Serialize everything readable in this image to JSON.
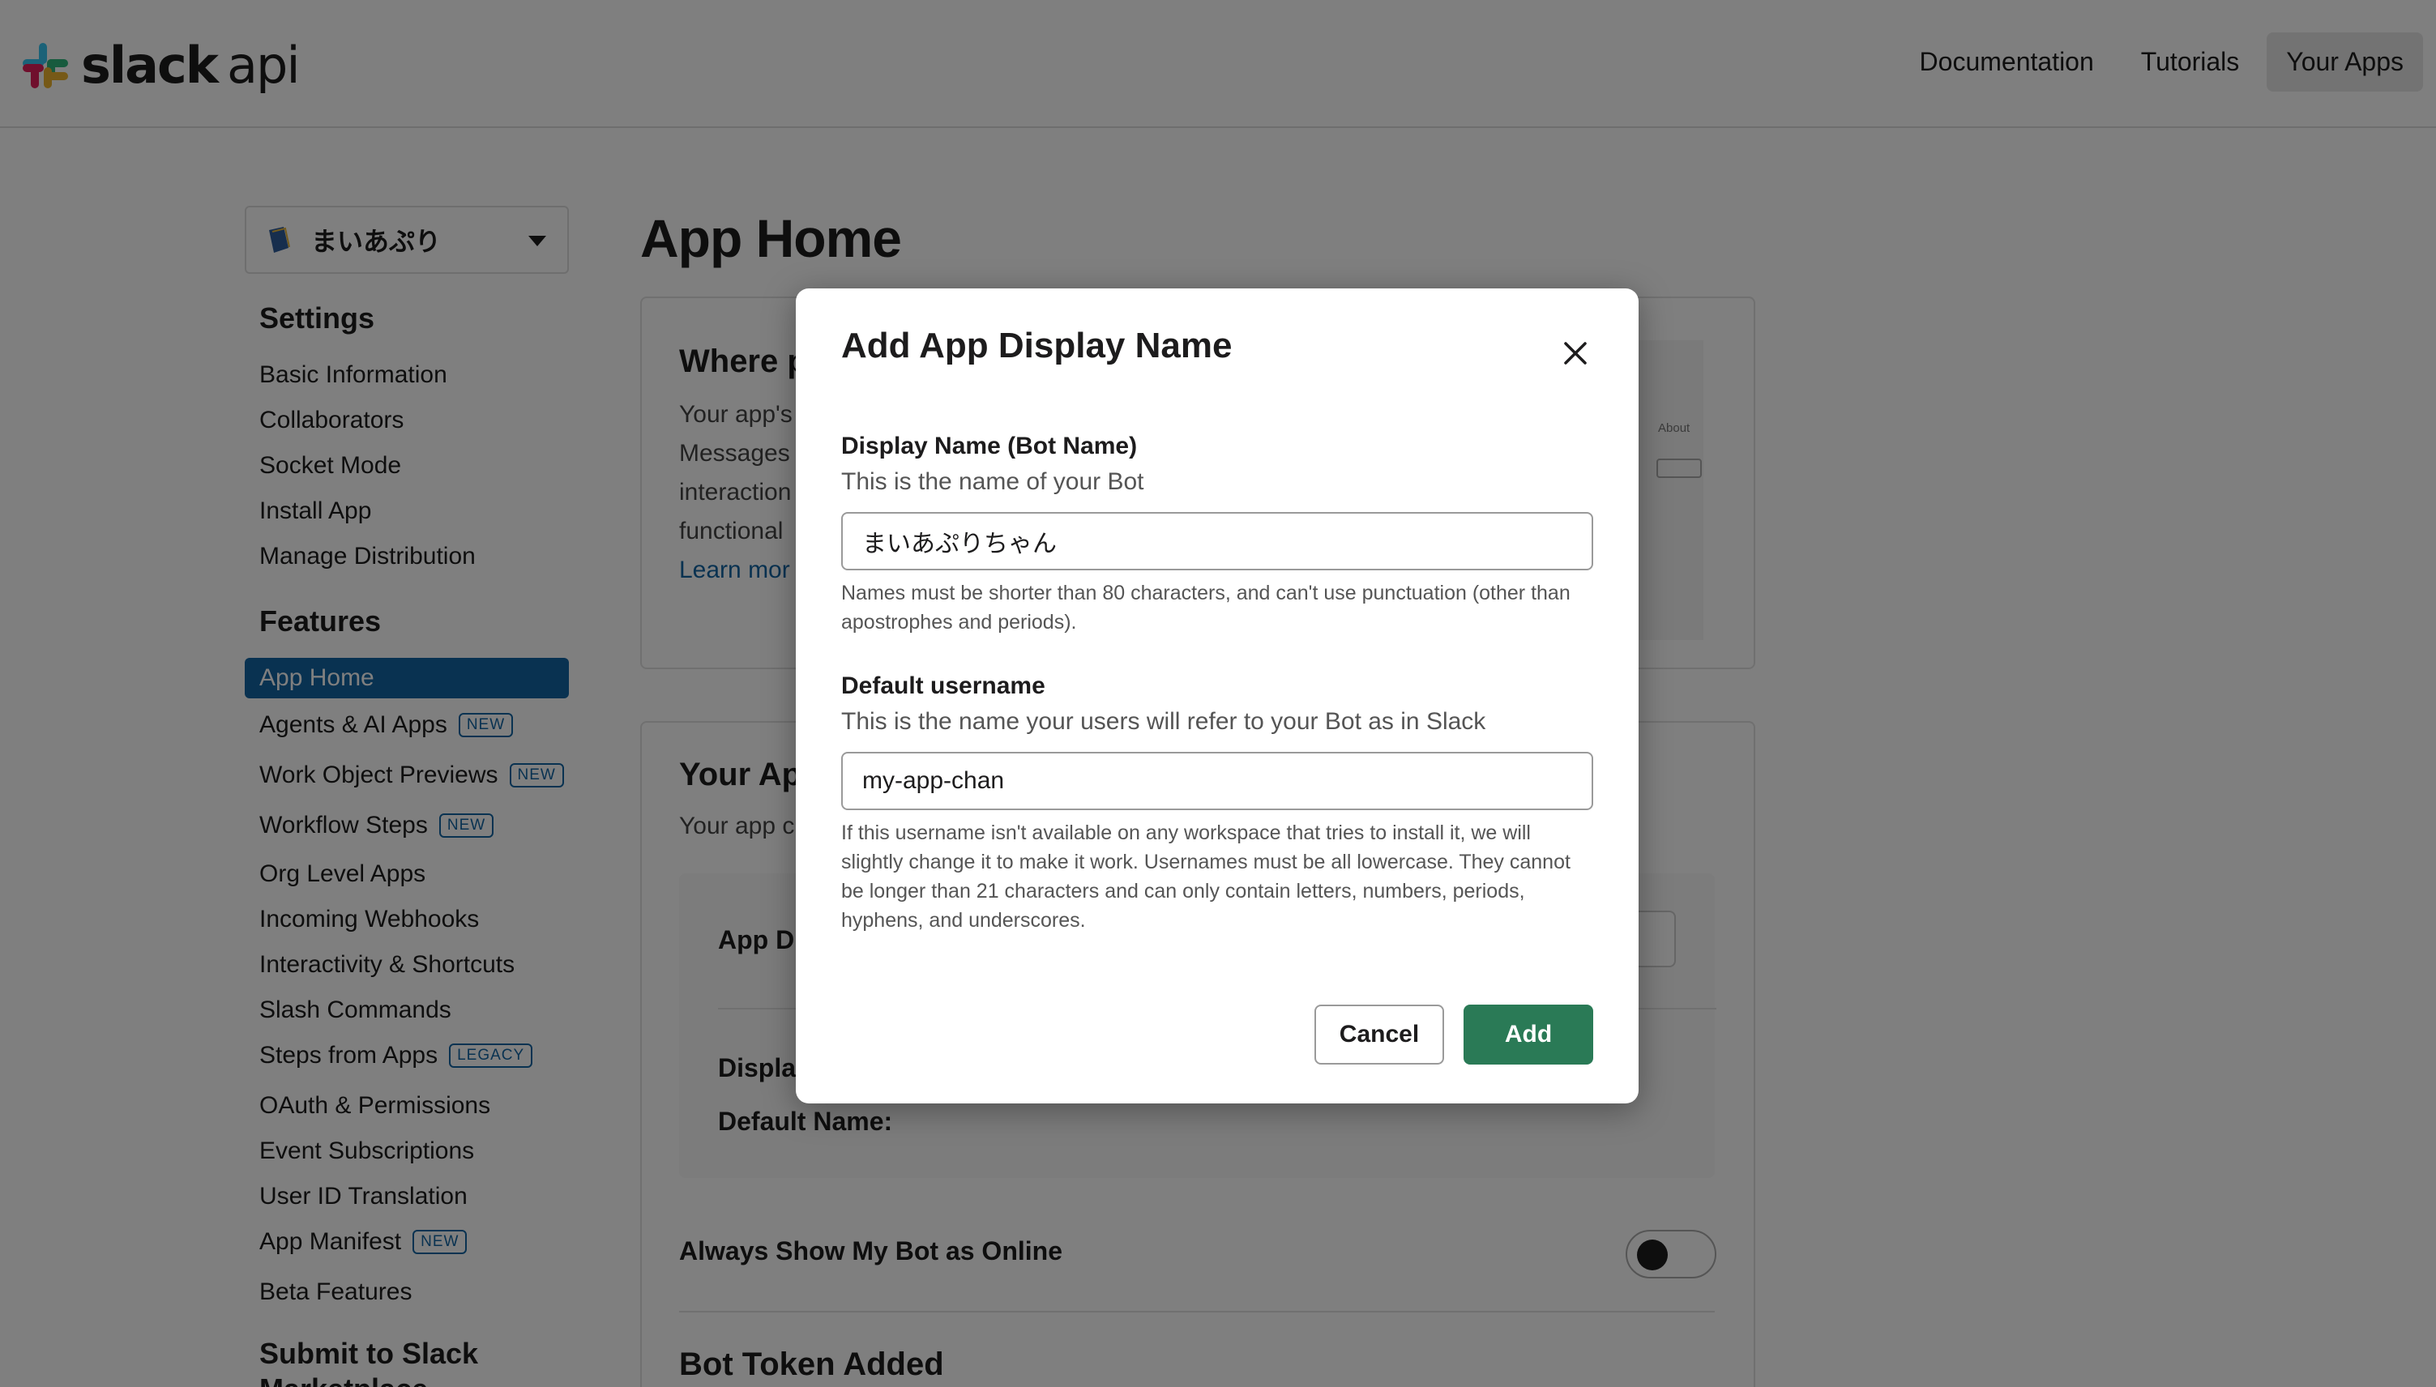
{
  "header": {
    "logo_brand": "slack",
    "logo_suffix": "api",
    "nav": [
      {
        "label": "Documentation"
      },
      {
        "label": "Tutorials"
      },
      {
        "label": "Your Apps"
      }
    ]
  },
  "sidebar": {
    "app_name": "まいあぷり",
    "settings_heading": "Settings",
    "settings_items": [
      {
        "label": "Basic Information"
      },
      {
        "label": "Collaborators"
      },
      {
        "label": "Socket Mode"
      },
      {
        "label": "Install App"
      },
      {
        "label": "Manage Distribution"
      }
    ],
    "features_heading": "Features",
    "features_items": [
      {
        "label": "App Home"
      },
      {
        "label": "Agents & AI Apps",
        "badge": "NEW"
      },
      {
        "label": "Work Object Previews",
        "badge": "NEW"
      },
      {
        "label": "Workflow Steps",
        "badge": "NEW"
      },
      {
        "label": "Org Level Apps"
      },
      {
        "label": "Incoming Webhooks"
      },
      {
        "label": "Interactivity & Shortcuts"
      },
      {
        "label": "Slash Commands"
      },
      {
        "label": "Steps from Apps",
        "badge": "LEGACY"
      },
      {
        "label": "OAuth & Permissions"
      },
      {
        "label": "Event Subscriptions"
      },
      {
        "label": "User ID Translation"
      },
      {
        "label": "App Manifest",
        "badge": "NEW"
      },
      {
        "label": "Beta Features"
      }
    ],
    "submit_heading_line1": "Submit to Slack",
    "submit_heading_line2": "Marketplace"
  },
  "main": {
    "page_title": "App Home",
    "where_card": {
      "title": "Where p",
      "lines": [
        "Your app's",
        "Messages",
        "interaction",
        "functional"
      ],
      "learn_more": "Learn mor",
      "preview_label": "About"
    },
    "your_app_card": {
      "title": "Your Ap",
      "subtitle": "Your app c",
      "app_display_label": "App Di",
      "display_label": "Display",
      "default_name_label": "Default Name:"
    },
    "always_online_label": "Always Show My Bot as Online",
    "bot_token_heading": "Bot Token Added"
  },
  "modal": {
    "title": "Add App Display Name",
    "display_name_label": "Display Name (Bot Name)",
    "display_name_sub": "This is the name of your Bot",
    "display_name_value": "まいあぷりちゃん",
    "display_name_help": "Names must be shorter than 80 characters, and can't use punctuation (other than apostrophes and periods).",
    "username_label": "Default username",
    "username_sub": "This is the name your users will refer to your Bot as in Slack",
    "username_value": "my-app-chan",
    "username_help": "If this username isn't available on any workspace that tries to install it, we will slightly change it to make it work. Usernames must be all lowercase. They cannot be longer than 21 characters and can only contain letters, numbers, periods, hyphens, and underscores.",
    "cancel_label": "Cancel",
    "add_label": "Add"
  },
  "colors": {
    "accent_blue": "#1264a3",
    "add_green": "#2a7a56"
  }
}
